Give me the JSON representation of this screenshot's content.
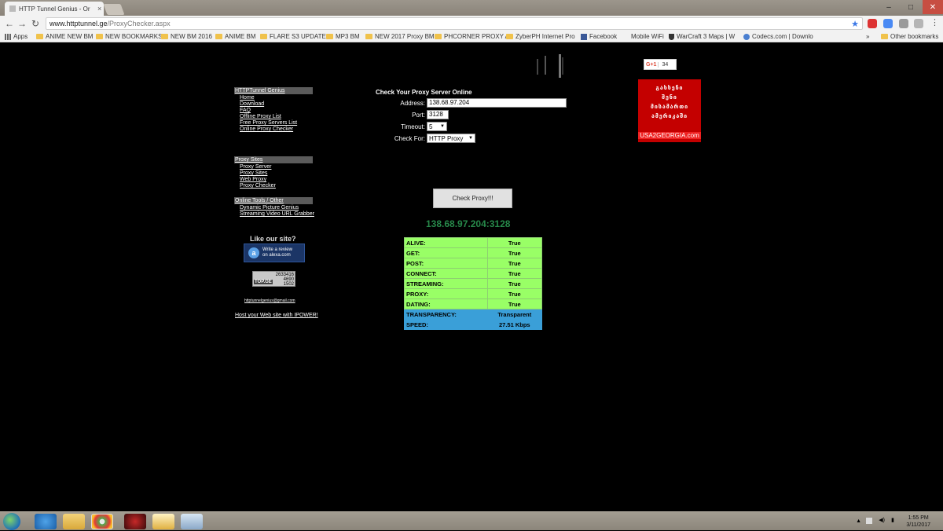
{
  "browser": {
    "tab_title": "HTTP Tunnel Genius - Or",
    "tab_close": "×",
    "url_host": "www.httptunnel.ge",
    "url_path": "/ProxyChecker.aspx",
    "win_minimize": "–",
    "win_maximize": "□",
    "win_close": "✕",
    "back_icon": "←",
    "forward_icon": "→",
    "reload_icon": "↻",
    "star_icon": "★"
  },
  "bookmarks": {
    "apps": "Apps",
    "items": [
      "ANIME NEW BM",
      "NEW BOOKMARKS",
      "NEW BM 2016",
      "ANIME BM",
      "FLARE S3 UPDATES",
      "MP3 BM",
      "NEW 2017 Proxy BM",
      "PHCORNER PROXY A",
      "ZyberPH Internet Pro",
      "Facebook",
      "Mobile WiFi",
      "WarCraft 3 Maps | W",
      "Codecs.com | Downlo"
    ],
    "more": "»",
    "other": "Other bookmarks"
  },
  "sidebar": {
    "section1": {
      "heading": "HTTPTunnel Genius",
      "links": [
        "Home",
        "Download",
        "FAQ",
        "Offline Proxy List",
        "Free Proxy Servers List",
        "Online Proxy Checker"
      ]
    },
    "section2": {
      "heading": "Proxy Sites",
      "links": [
        "Proxy Server",
        "Proxy Sites",
        "Web Proxy",
        "Proxy Checker"
      ]
    },
    "section3": {
      "heading": "Online Tools / Other",
      "links": [
        "Dynamic Picture Genius",
        "Streaming Video URL Grabber"
      ]
    },
    "like_text": "Like our site?",
    "alexa_line1": "Write a review",
    "alexa_line2": "on alexa.com",
    "counter_label": "TOP.GE",
    "counter_values": [
      "2633416",
      "4690",
      "1502"
    ],
    "email": "httptunnelgenius@gmail.com",
    "host_link": "Host your Web site with IPOWER!"
  },
  "form": {
    "title": "Check Your Proxy Server Online",
    "address_label": "Address:",
    "address_value": "138.68.97.204",
    "port_label": "Port:",
    "port_value": "3128",
    "timeout_label": "Timeout:",
    "timeout_value": "5",
    "checkfor_label": "Check For:",
    "checkfor_value": "HTTP Proxy",
    "dropdown_arrow": "▼",
    "button": "Check Proxy!!!"
  },
  "result": {
    "host": "138.68.97.204:3128",
    "rows": [
      {
        "label": "ALIVE:",
        "value": "True"
      },
      {
        "label": "GET:",
        "value": "True"
      },
      {
        "label": "POST:",
        "value": "True"
      },
      {
        "label": "CONNECT:",
        "value": "True"
      },
      {
        "label": "STREAMING:",
        "value": "True"
      },
      {
        "label": "PROXY:",
        "value": "True"
      },
      {
        "label": "DATING:",
        "value": "True"
      }
    ],
    "info_rows": [
      {
        "label": "TRANSPARENCY:",
        "value": "Transparent"
      },
      {
        "label": "SPEED:",
        "value": "27.51 Kbps"
      }
    ]
  },
  "social": {
    "gplus": "G+1",
    "gplus_count": "34"
  },
  "banner": {
    "georgian_line1": "გახსენი",
    "georgian_line2": "შენი",
    "georgian_line3": "მისამართი",
    "georgian_line4": "ამერიკაში",
    "url": "USA2GEORGIA.com"
  },
  "taskbar": {
    "time": "1:55 PM",
    "date": "3/11/2017"
  },
  "colors": {
    "result_green": "#99ff66",
    "result_blue": "#3a9fd8",
    "result_host": "#27894a",
    "banner_red": "#c40000"
  }
}
